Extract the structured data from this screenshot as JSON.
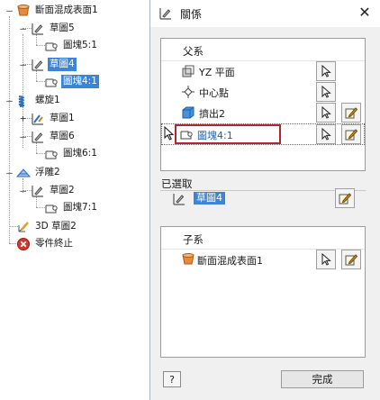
{
  "tree": {
    "items": [
      {
        "label": "斷面混成表面1",
        "icon": "loft-surface-icon",
        "selected": false
      },
      {
        "label": "草圖5",
        "icon": "sketch-icon",
        "selected": false
      },
      {
        "label": "圖塊5:1",
        "icon": "block-icon",
        "selected": false
      },
      {
        "label": "草圖4",
        "icon": "sketch-icon",
        "selected": true
      },
      {
        "label": "圖塊4:1",
        "icon": "block-icon",
        "selected": true
      },
      {
        "label": "螺旋1",
        "icon": "coil-icon",
        "selected": false
      },
      {
        "label": "草圖1",
        "icon": "sketch-icon",
        "selected": false
      },
      {
        "label": "草圖6",
        "icon": "sketch-icon",
        "selected": false
      },
      {
        "label": "圖塊6:1",
        "icon": "block-icon",
        "selected": false
      },
      {
        "label": "浮雕2",
        "icon": "emboss-icon",
        "selected": false
      },
      {
        "label": "草圖2",
        "icon": "sketch-icon",
        "selected": false
      },
      {
        "label": "圖塊7:1",
        "icon": "block-icon",
        "selected": false
      },
      {
        "label": "3D 草圖2",
        "icon": "sketch-3d-icon",
        "selected": false
      },
      {
        "label": "零件終止",
        "icon": "end-of-part-icon",
        "selected": false
      }
    ]
  },
  "dialog": {
    "title": "關係",
    "parents": {
      "header": "父系",
      "rows": [
        {
          "label": "YZ 平面",
          "icon": "plane-icon"
        },
        {
          "label": "中心點",
          "icon": "center-point-icon"
        },
        {
          "label": "擠出2",
          "icon": "extrude-icon"
        },
        {
          "label": "圖塊4:1",
          "icon": "block-icon"
        }
      ]
    },
    "selected": {
      "label": "已選取",
      "value": "草圖4"
    },
    "children": {
      "header": "子系",
      "rows": [
        {
          "label": "斷面混成表面1",
          "icon": "loft-surface-icon"
        }
      ]
    },
    "help_label": "?",
    "ok_label": "完成"
  },
  "colors": {
    "selection": "#3c84d8",
    "highlight_box": "#b0282e",
    "dialog_bg": "#f0f0f0"
  }
}
